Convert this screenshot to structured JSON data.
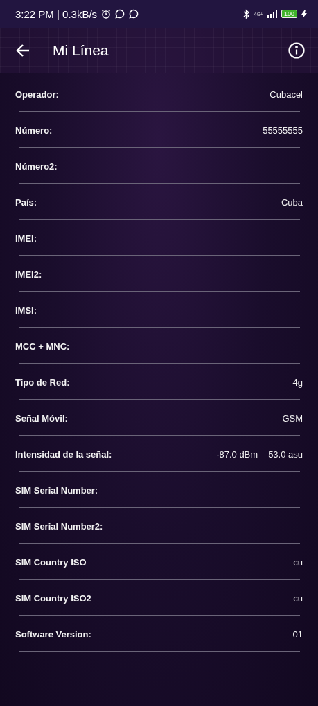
{
  "status_bar": {
    "time": "3:22 PM | 0.3kB/s",
    "network": "4G+",
    "battery": "100",
    "charging": true
  },
  "app_bar": {
    "title": "Mi Línea"
  },
  "rows": [
    {
      "label": "Operador:",
      "values": [
        "Cubacel"
      ]
    },
    {
      "label": "Número:",
      "values": [
        "55555555"
      ]
    },
    {
      "label": "Número2:"
    },
    {
      "label": "País:",
      "values": [
        "Cuba"
      ]
    },
    {
      "label": "IMEI:"
    },
    {
      "label": "IMEI2:"
    },
    {
      "label": "IMSI:"
    },
    {
      "label": "MCC + MNC:"
    },
    {
      "label": "Tipo de Red:",
      "values": [
        "4g"
      ]
    },
    {
      "label": "Señal Móvil:",
      "values": [
        "GSM"
      ]
    },
    {
      "label": "Intensidad de la señal:",
      "values": [
        "-87.0 dBm",
        "53.0 asu"
      ]
    },
    {
      "label": "SIM Serial Number:"
    },
    {
      "label": "SIM Serial Number2:"
    },
    {
      "label": "SIM Country ISO",
      "values": [
        "cu"
      ]
    },
    {
      "label": "SIM Country ISO2",
      "values": [
        "cu"
      ]
    },
    {
      "label": "Software Version:",
      "values": [
        "01"
      ]
    }
  ]
}
